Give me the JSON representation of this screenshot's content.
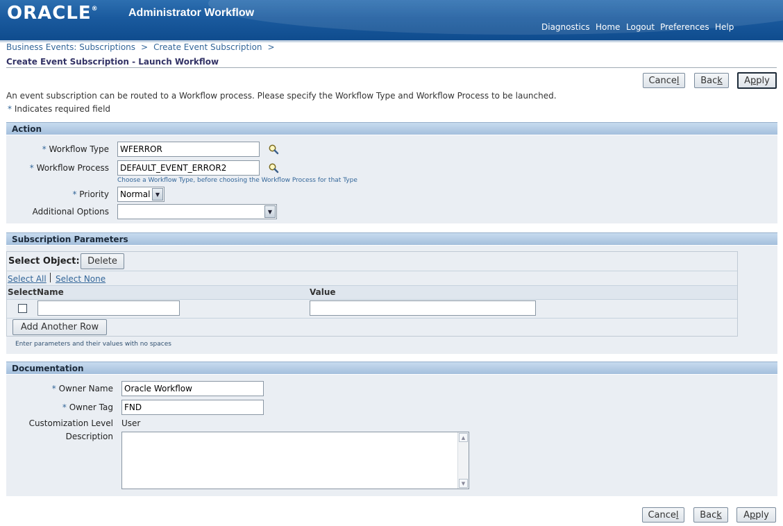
{
  "header": {
    "logo": "ORACLE",
    "app_title": "Administrator Workflow",
    "links": [
      "Diagnostics",
      "Home",
      "Logout",
      "Preferences",
      "Help"
    ]
  },
  "breadcrumb": [
    "Business Events: Subscriptions",
    "Create Event Subscription"
  ],
  "breadcrumb_separator": ">",
  "page_title": "Create Event Subscription - Launch Workflow",
  "buttons": {
    "cancel_pre": "Cance",
    "cancel_key": "l",
    "back_pre": "Bac",
    "back_key": "k",
    "apply_pre": "A",
    "apply_key": "p",
    "apply_post": "ply"
  },
  "intro": "An event subscription can be routed to a Workflow process. Please specify the Workflow Type and Workflow Process to be launched.",
  "required_note": "Indicates required field",
  "required_star": "*",
  "action": {
    "section_title": "Action",
    "workflow_type_label": "Workflow Type",
    "workflow_type_value": "WFERROR",
    "workflow_process_label": "Workflow Process",
    "workflow_process_value": "DEFAULT_EVENT_ERROR2",
    "process_hint": "Choose a Workflow Type, before choosing the Workflow Process for that Type",
    "priority_label": "Priority",
    "priority_value": "Normal",
    "additional_options_label": "Additional Options",
    "additional_options_value": ""
  },
  "params": {
    "section_title": "Subscription Parameters",
    "select_object_label": "Select Object:",
    "delete_button": "Delete",
    "select_all": "Select All",
    "select_none": "Select None",
    "col_select": "Select",
    "col_name": "Name",
    "col_value": "Value",
    "row_name": "",
    "row_value": "",
    "add_row_button": "Add Another Row",
    "hint": "Enter parameters and their values with no spaces"
  },
  "documentation": {
    "section_title": "Documentation",
    "owner_name_label": "Owner Name",
    "owner_name_value": "Oracle Workflow",
    "owner_tag_label": "Owner Tag",
    "owner_tag_value": "FND",
    "customization_label": "Customization Level",
    "customization_value": "User",
    "description_label": "Description",
    "description_value": ""
  },
  "colors": {
    "header_blue": "#1a5a9e",
    "link_blue": "#336699",
    "section_bg": "#eaeef3"
  },
  "icons": [
    "search-icon",
    "chevron-down-icon"
  ]
}
